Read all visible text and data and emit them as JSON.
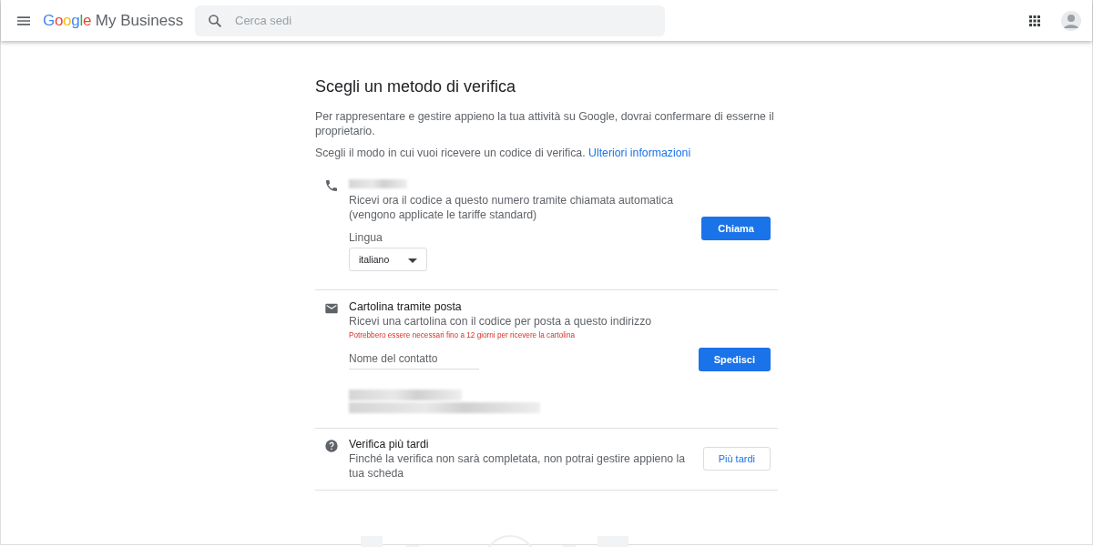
{
  "header": {
    "logo_google": "Google",
    "logo_product": "My Business",
    "search": {
      "placeholder": "Cerca sedi"
    }
  },
  "title": "Scegli un metodo di verifica",
  "intro": "Per rappresentare e gestire appieno la tua attività su Google, dovrai confermare di esserne il proprietario.",
  "choose_text": "Scegli il modo in cui vuoi ricevere un codice di verifica.",
  "learn_more_link": "Ulteriori informazioni",
  "options": [
    {
      "kind": "call",
      "description": "Ricevi ora il codice a questo numero tramite chiamata automatica (vengono applicate le tariffe standard)",
      "language_label": "Lingua",
      "language_value": "italiano",
      "button": "Chiama",
      "primary": true
    },
    {
      "kind": "postcard",
      "heading": "Cartolina tramite posta",
      "description": "Ricevi una cartolina con il codice per posta a questo indirizzo",
      "warning": "Potrebbero essere necessari fino a 12 giorni per ricevere la cartolina",
      "contact_field": {
        "placeholder": "Nome del contatto"
      },
      "button": "Spedisci",
      "primary": true
    },
    {
      "kind": "later",
      "heading": "Verifica più tardi",
      "description": "Finché la verifica non sarà completata, non potrai gestire appieno la tua scheda",
      "button": "Più tardi",
      "primary": false
    }
  ]
}
